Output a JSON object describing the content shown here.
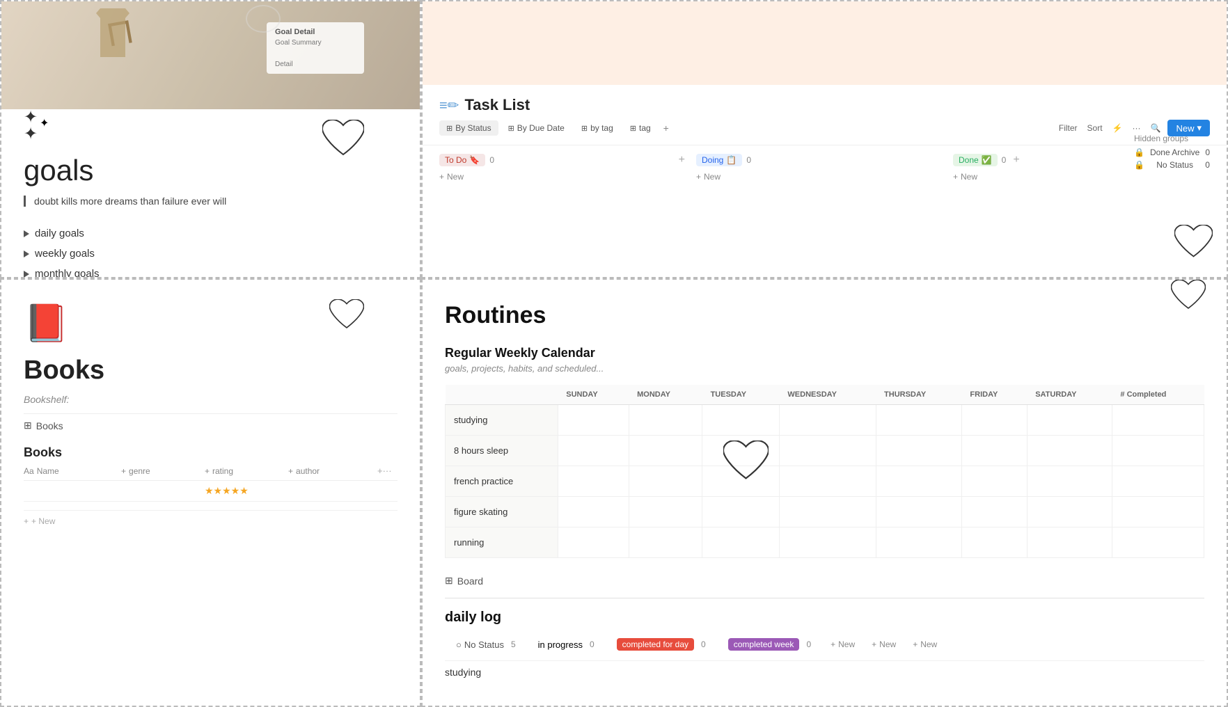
{
  "goals": {
    "title": "goals",
    "quote": "doubt kills more dreams than failure ever will",
    "items": [
      {
        "label": "daily goals"
      },
      {
        "label": "weekly goals"
      },
      {
        "label": "monthly goals"
      }
    ]
  },
  "taskList": {
    "title": "Task List",
    "tabs": [
      {
        "label": "By Status",
        "icon": "⊞",
        "active": true
      },
      {
        "label": "By Due Date",
        "icon": "⊞"
      },
      {
        "label": "by tag",
        "icon": "⊞"
      },
      {
        "label": "tag",
        "icon": "⊞"
      }
    ],
    "toolbar": {
      "filter": "Filter",
      "sort": "Sort",
      "lightning": "⚡",
      "more": "···",
      "search": "🔍",
      "new_button": "New"
    },
    "columns": [
      {
        "label": "To Do",
        "emoji": "🔖",
        "count": 0,
        "badge_class": "badge-todo"
      },
      {
        "label": "Doing",
        "emoji": "📋",
        "count": 0,
        "badge_class": "badge-doing"
      },
      {
        "label": "Done",
        "emoji": "✅",
        "count": 0,
        "badge_class": "badge-done"
      }
    ],
    "hidden_groups": {
      "title": "Hidden groups",
      "items": [
        {
          "label": "Done Archive",
          "count": 0
        },
        {
          "label": "No Status",
          "count": 0
        }
      ]
    }
  },
  "books": {
    "title": "Books",
    "bookshelf_label": "Bookshelf:",
    "db_link": "Books",
    "table_title": "Books",
    "columns": [
      {
        "label": "Name",
        "icon": "Aa"
      },
      {
        "label": "genre",
        "icon": "+"
      },
      {
        "label": "rating",
        "icon": "+"
      },
      {
        "label": "author",
        "icon": "+"
      }
    ],
    "rows": [
      {
        "name": "",
        "genre": "",
        "rating": "★★★★★",
        "author": ""
      }
    ],
    "add_new": "+ New"
  },
  "routines": {
    "title": "Routines",
    "calendar": {
      "title": "Regular Weekly Calendar",
      "subtitle": "goals, projects, habits, and scheduled...",
      "days": [
        "SUNDAY",
        "MONDAY",
        "TUESDAY",
        "WEDNESDAY",
        "THURSDAY",
        "FRIDAY",
        "SATURDAY",
        "# Completed"
      ],
      "activities": [
        {
          "label": "studying"
        },
        {
          "label": "8 hours sleep"
        },
        {
          "label": "french practice"
        },
        {
          "label": "figure skating"
        },
        {
          "label": "running"
        }
      ]
    },
    "board_link": "Board",
    "daily_log": {
      "title": "daily log",
      "statuses": [
        {
          "label": "No Status",
          "count": 5,
          "type": "none"
        },
        {
          "label": "in progress",
          "count": 0,
          "type": "plain"
        },
        {
          "label": "completed for day",
          "count": 0,
          "type": "day"
        },
        {
          "label": "completed week",
          "count": 0,
          "type": "week"
        }
      ],
      "items": [
        {
          "label": "studying"
        }
      ]
    }
  }
}
